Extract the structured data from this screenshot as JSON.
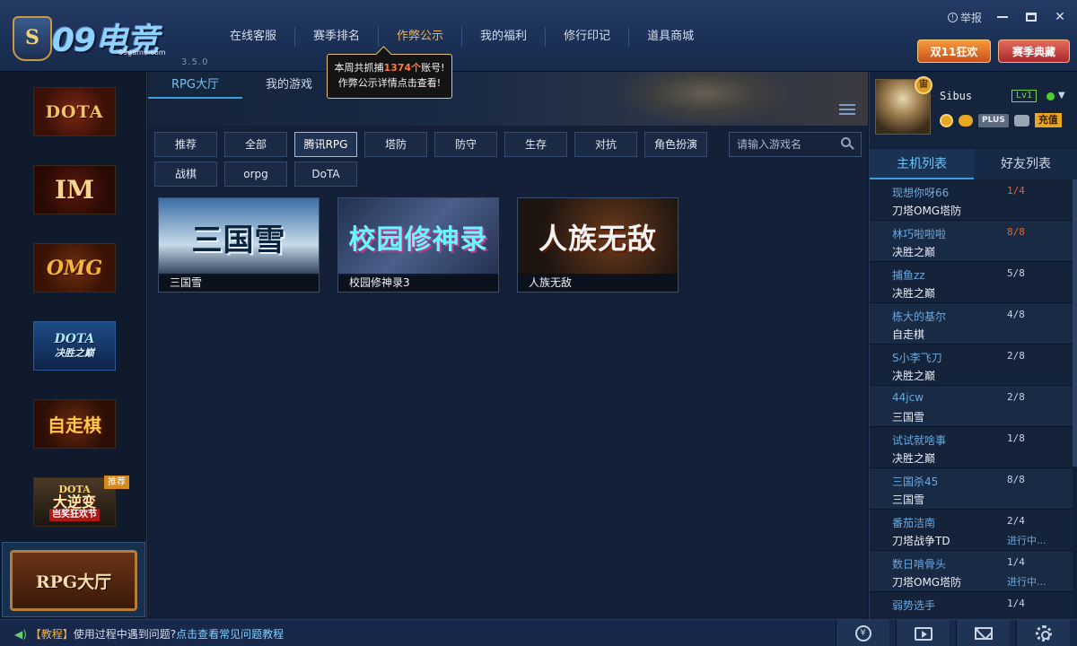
{
  "header": {
    "logo_text": "09电竞",
    "logo_badge": "S",
    "logo_domain": "09game.com",
    "version": "3.5.0",
    "nav": [
      "在线客服",
      "赛季排名",
      "作弊公示",
      "我的福利",
      "修行印记",
      "道具商城"
    ],
    "active_nav": "作弊公示",
    "report_label": "举报",
    "promo_1": "双11狂欢",
    "promo_2": "赛季典藏"
  },
  "tooltip": {
    "line1_prefix": "本周共抓捕",
    "count": "1374个",
    "line1_suffix": "账号!",
    "line2": "作弊公示详情点击查看!"
  },
  "sidebar": {
    "games": [
      {
        "label": "DOTA"
      },
      {
        "label": "IM"
      },
      {
        "label": "OMG"
      },
      {
        "label": "DOTA",
        "sub": "决胜之巅"
      },
      {
        "label": "自走棋"
      },
      {
        "label_top": "DOTA",
        "label": "大逆变",
        "label_bottom": "岂奖狂欢节"
      }
    ],
    "recommend_badge": "推荐",
    "rpg_hall": "RPG大厅"
  },
  "main": {
    "tabs": [
      "RPG大厅",
      "我的游戏"
    ],
    "filters_row1": [
      "推荐",
      "全部",
      "腾讯RPG",
      "塔防",
      "防守",
      "生存",
      "对抗",
      "角色扮演"
    ],
    "filters_row2": [
      "战棋",
      "orpg",
      "DoTA"
    ],
    "active_filter": "腾讯RPG",
    "search_placeholder": "请输入游戏名",
    "cards": [
      {
        "art": "三国雪",
        "name": "三国雪"
      },
      {
        "art": "校园修神录",
        "name": "校园修神录3"
      },
      {
        "art": "人族无敌",
        "name": "人族无敌"
      }
    ]
  },
  "profile": {
    "username": "Sibus",
    "level": "Lv1",
    "vip_mark": "宙",
    "plus_label": "PLUS",
    "recharge_label": "充值"
  },
  "right_tabs": [
    "主机列表",
    "好友列表"
  ],
  "hosts": [
    {
      "name": "现想你呀66",
      "count": "1/4",
      "map": "刀塔OMG塔防",
      "state": "",
      "full": true
    },
    {
      "name": "林巧啦啦啦",
      "count": "8/8",
      "map": "决胜之巅",
      "state": "",
      "full": true
    },
    {
      "name": "捕鱼zz",
      "count": "5/8",
      "map": "决胜之巅",
      "state": "",
      "full": false
    },
    {
      "name": "栋大的基尔",
      "count": "4/8",
      "map": "自走棋",
      "state": "",
      "full": false
    },
    {
      "name": "S小李飞刀",
      "count": "2/8",
      "map": "决胜之巅",
      "state": "",
      "full": false
    },
    {
      "name": "44jcw",
      "count": "2/8",
      "map": "三国雪",
      "state": "",
      "full": false
    },
    {
      "name": "试试就啥事",
      "count": "1/8",
      "map": "决胜之巅",
      "state": "",
      "full": false
    },
    {
      "name": "三国杀45",
      "count": "8/8",
      "map": "三国雪",
      "state": "",
      "full": false
    },
    {
      "name": "番茄洁南",
      "count": "2/4",
      "map": "刀塔战争TD",
      "state": "进行中...",
      "full": false
    },
    {
      "name": "数日啃骨头",
      "count": "1/4",
      "map": "刀塔OMG塔防",
      "state": "进行中...",
      "full": false
    },
    {
      "name": "弱势选手",
      "count": "1/4",
      "map": "",
      "state": "",
      "full": false
    }
  ],
  "footer": {
    "tag": "【教程】",
    "text": "使用过程中遇到问题?",
    "link": "点击查看常见问题教程",
    "buttons": [
      "yuan-icon",
      "video-icon",
      "mail-icon",
      "settings-icon"
    ],
    "yuan_glyph": "¥"
  }
}
